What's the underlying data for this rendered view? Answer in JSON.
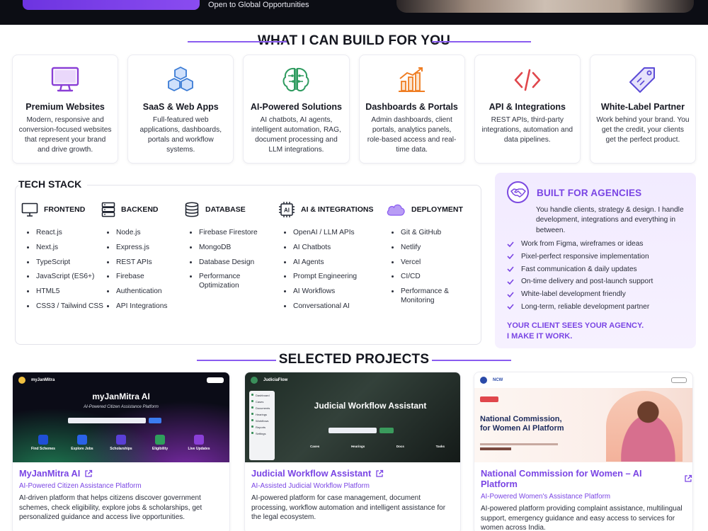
{
  "hero": {
    "tagline": "Open to Global Opportunities"
  },
  "services": {
    "heading": "WHAT I CAN BUILD FOR YOU",
    "items": [
      {
        "title": "Premium Websites",
        "desc": "Modern, responsive and conversion-focused websites that represent your brand and drive growth.",
        "icon": "monitor-icon",
        "color": "#8a3fd6"
      },
      {
        "title": "SaaS & Web Apps",
        "desc": "Full-featured web applications, dashboards, portals and workflow systems.",
        "icon": "cubes-icon",
        "color": "#3a7bd5"
      },
      {
        "title": "AI-Powered Solutions",
        "desc": "AI chatbots, AI agents, intelligent automation, RAG, document processing and LLM integrations.",
        "icon": "brain-icon",
        "color": "#2e9b5f"
      },
      {
        "title": "Dashboards & Portals",
        "desc": "Admin dashboards, client portals, analytics panels, role-based access and real-time data.",
        "icon": "bar-chart-icon",
        "color": "#ef7d22"
      },
      {
        "title": "API & Integrations",
        "desc": "REST APIs, third-party integrations, automation and data pipelines.",
        "icon": "code-icon",
        "color": "#e0474c"
      },
      {
        "title": "White-Label Partner",
        "desc": "Work behind your brand. You get the credit, your clients get the perfect product.",
        "icon": "tag-icon",
        "color": "#5b4bd6"
      }
    ]
  },
  "tech": {
    "title": "TECH STACK",
    "columns": [
      {
        "name": "FRONTEND",
        "icon": "monitor-icon",
        "items": [
          "React.js",
          "Next.js",
          "TypeScript",
          "JavaScript (ES6+)",
          "HTML5",
          "CSS3 / Tailwind CSS"
        ]
      },
      {
        "name": "BACKEND",
        "icon": "server-icon",
        "items": [
          "Node.js",
          "Express.js",
          "REST APIs",
          "Firebase",
          "Authentication",
          "API Integrations"
        ]
      },
      {
        "name": "DATABASE",
        "icon": "database-icon",
        "items": [
          "Firebase Firestore",
          "MongoDB",
          "Database Design",
          "Performance Optimization"
        ]
      },
      {
        "name": "AI & INTEGRATIONS",
        "icon": "ai-chip-icon",
        "items": [
          "OpenAI / LLM APIs",
          "AI Chatbots",
          "AI Agents",
          "Prompt Engineering",
          "AI Workflows",
          "Conversational AI"
        ]
      },
      {
        "name": "DEPLOYMENT",
        "icon": "cloud-icon",
        "items": [
          "Git & GitHub",
          "Netlify",
          "Vercel",
          "CI/CD",
          "Performance & Monitoring"
        ]
      }
    ]
  },
  "agency": {
    "title": "BUILT FOR AGENCIES",
    "intro": "You handle clients, strategy & design. I handle development, integrations and everything in between.",
    "points": [
      "Work from Figma, wireframes or ideas",
      "Pixel-perfect responsive implementation",
      "Fast communication & daily updates",
      "On-time delivery and post-launch support",
      "White-label development friendly",
      "Long-term, reliable development partner"
    ],
    "tagline_1": "YOUR CLIENT SEES YOUR AGENCY.",
    "tagline_2": "I MAKE IT WORK."
  },
  "projects": {
    "heading": "SELECTED PROJECTS",
    "items": [
      {
        "title": "MyJanMitra AI",
        "subtitle": "AI-Powered Citizen Assistance Platform",
        "desc": "AI-driven platform that helps citizens discover government schemes, check eligibility, explore jobs & scholarships, get personalized guidance and access live opportunities.",
        "shot_brand": "myJanMitra",
        "shot_title": "myJanMitra AI",
        "shot_subtitle": "AI-Powered Citizen Assistance Platform",
        "shot_tiles": [
          "Find Schemes",
          "Explore Jobs",
          "Scholarships",
          "Eligibility",
          "Live Updates"
        ]
      },
      {
        "title": "Judicial Workflow Assistant",
        "subtitle": "AI-Assisted Judicial Workflow Platform",
        "desc": "AI-powered platform for case management, document processing, workflow automation and intelligent assistance for the legal ecosystem.",
        "shot_brand": "JudiciaFlow",
        "shot_title": "Judicial Workflow Assistant",
        "shot_sidebar": [
          "Dashboard",
          "Cases",
          "Documents",
          "Hearings",
          "Workflows",
          "Reports",
          "Settings"
        ],
        "shot_stats": [
          "Cases",
          "Hearings",
          "Docs",
          "Tasks"
        ]
      },
      {
        "title": "National Commission for Women – AI Platform",
        "subtitle": "AI-Powered Women's Assistance Platform",
        "desc": "AI-powered platform providing complaint assistance, multilingual support, emergency guidance and easy access to services for women across India.",
        "shot_brand": "NCW",
        "shot_title": "National Commission, for Women AI Platform"
      }
    ]
  },
  "colors": {
    "accent": "#7a45e4",
    "dark": "#0c0d14"
  }
}
